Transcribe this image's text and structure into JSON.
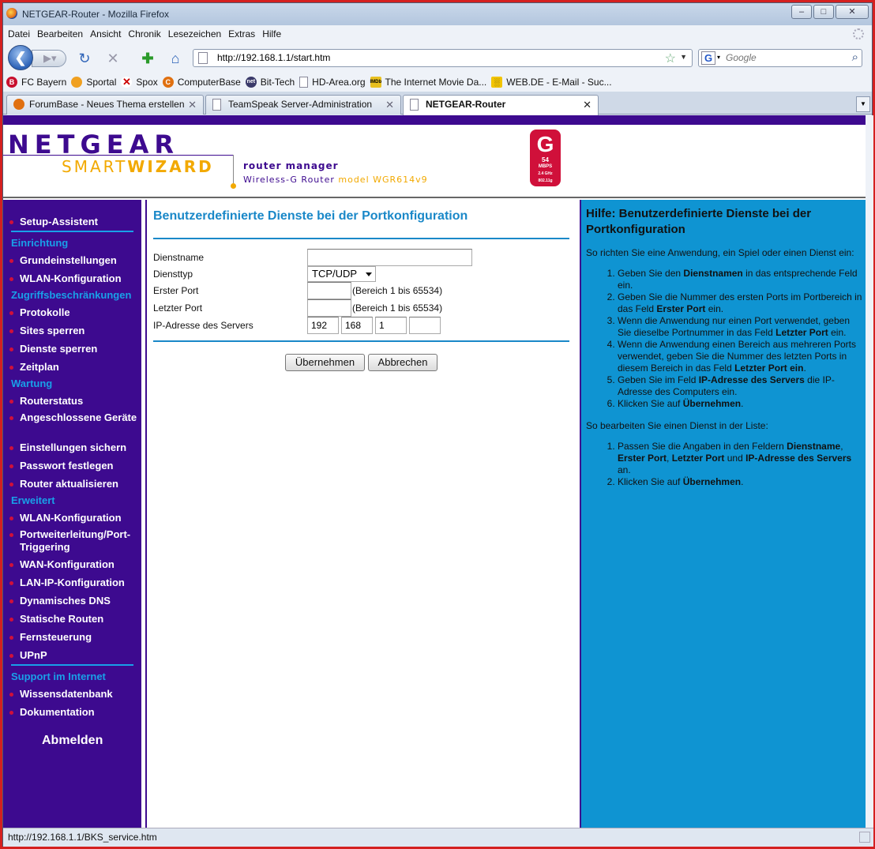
{
  "window": {
    "title": "NETGEAR-Router - Mozilla Firefox"
  },
  "menu": [
    "Datei",
    "Bearbeiten",
    "Ansicht",
    "Chronik",
    "Lesezeichen",
    "Extras",
    "Hilfe"
  ],
  "nav": {
    "url": "http://192.168.1.1/start.htm",
    "search_placeholder": "Google"
  },
  "bookmarks": [
    "FC Bayern",
    "Sportal",
    "Spox",
    "ComputerBase",
    "Bit-Tech",
    "HD-Area.org",
    "The Internet Movie Da...",
    "WEB.DE - E-Mail - Suc..."
  ],
  "tabs": [
    "ForumBase - Neues Thema erstellen",
    "TeamSpeak Server-Administration",
    "NETGEAR-Router"
  ],
  "header": {
    "brand": "NETGEAR",
    "smart": "SMART",
    "wizard": "WIZARD",
    "router_manager": "router manager",
    "model_prefix": "Wireless-G Router",
    "model": "model WGR614v9",
    "badge_letter": "G",
    "badge_speed": "54",
    "badge_unit": "MBPS",
    "badge_freq": "2.4 GHz",
    "badge_std": "802.11g"
  },
  "sidebar": {
    "setup": "Setup-Assistent",
    "sections": [
      {
        "head": "Einrichtung",
        "items": [
          "Grundeinstellungen",
          "WLAN-Konfiguration"
        ]
      },
      {
        "head": "Zugriffsbeschränkungen",
        "items": [
          "Protokolle",
          "Sites sperren",
          "Dienste sperren",
          "Zeitplan"
        ]
      },
      {
        "head": "Wartung",
        "items": [
          "Routerstatus",
          "Angeschlossene Geräte",
          "Einstellungen sichern",
          "Passwort festlegen",
          "Router aktualisieren"
        ]
      },
      {
        "head": "Erweitert",
        "items": [
          "WLAN-Konfiguration",
          "Portweiterleitung/Port-Triggering",
          "WAN-Konfiguration",
          "LAN-IP-Konfiguration",
          "Dynamisches DNS",
          "Statische Routen",
          "Fernsteuerung",
          "UPnP"
        ]
      },
      {
        "head": "Support im Internet",
        "items": [
          "Wissensdatenbank",
          "Dokumentation"
        ]
      }
    ],
    "logout": "Abmelden"
  },
  "form": {
    "title": "Benutzerdefinierte Dienste bei der Portkonfiguration",
    "service_name_label": "Dienstname",
    "service_name_value": "",
    "service_type_label": "Diensttyp",
    "service_type_value": "TCP/UDP",
    "first_port_label": "Erster Port",
    "first_port_value": "",
    "first_port_range": "(Bereich 1 bis 65534)",
    "last_port_label": "Letzter Port",
    "last_port_value": "",
    "last_port_range": "(Bereich 1 bis 65534)",
    "ip_label": "IP-Adresse des Servers",
    "ip": [
      "192",
      "168",
      "1",
      ""
    ],
    "apply": "Übernehmen",
    "cancel": "Abbrechen"
  },
  "help": {
    "title": "Hilfe: Benutzerdefinierte Dienste bei der Portkonfiguration",
    "intro1": "So richten Sie eine Anwendung, ein Spiel oder einen Dienst ein:",
    "steps1": [
      "Geben Sie den |Dienstnamen| in das entsprechende Feld ein.",
      "Geben Sie die Nummer des ersten Ports im Portbereich in das Feld |Erster Port| ein.",
      "Wenn die Anwendung nur einen Port verwendet, geben Sie dieselbe Portnummer in das Feld |Letzter Port| ein.",
      "Wenn die Anwendung einen Bereich aus mehreren Ports verwendet, geben Sie die Nummer des letzten Ports in diesem Bereich in das Feld |Letzter Port ein|.",
      "Geben Sie im Feld |IP-Adresse des Servers| die IP-Adresse des Computers ein.",
      "Klicken Sie auf |Übernehmen|."
    ],
    "intro2": "So bearbeiten Sie einen Dienst in der Liste:",
    "steps2": [
      "Passen Sie die Angaben in den Feldern |Dienstname|, |Erster Port|, |Letzter Port| und |IP-Adresse des Servers| an.",
      "Klicken Sie auf |Übernehmen|."
    ]
  },
  "status": {
    "text": "http://192.168.1.1/BKS_service.htm"
  }
}
